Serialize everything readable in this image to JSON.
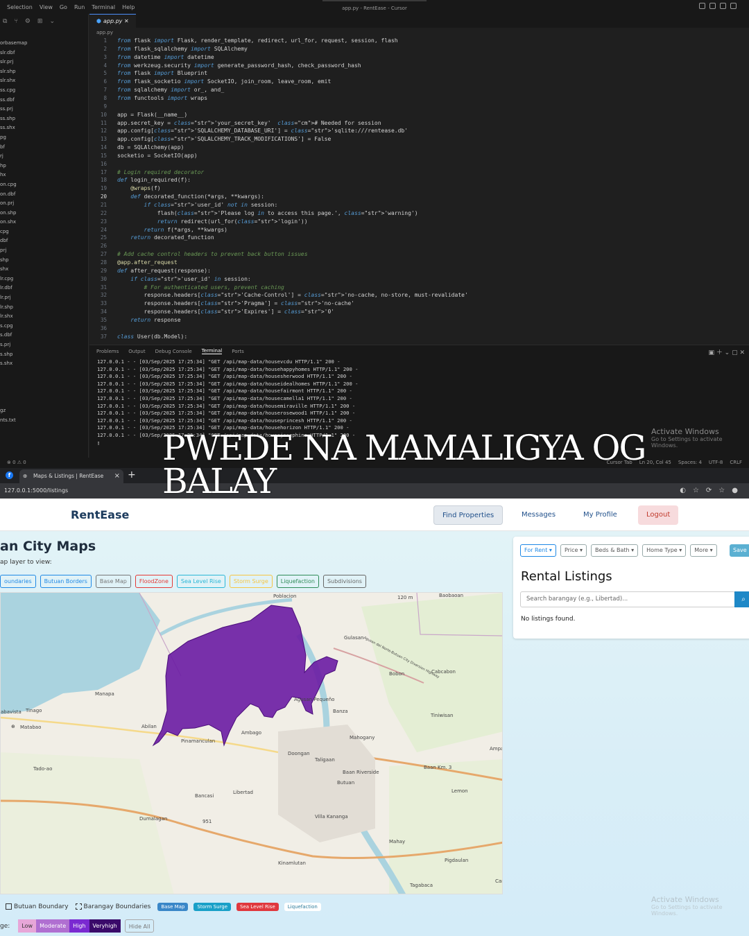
{
  "ide": {
    "menu": [
      "Selection",
      "View",
      "Go",
      "Run",
      "Terminal",
      "Help"
    ],
    "window_title": "app.py - RentEase - Cursor",
    "files": [
      "orbasemap",
      "slr.dbf",
      "slr.prj",
      "slr.shp",
      "slr.shx",
      "ss.cpg",
      "ss.dbf",
      "ss.prj",
      "ss.shp",
      "ss.shx",
      "pg",
      "bf",
      "rj",
      "hp",
      "hx",
      "on.cpg",
      "on.dbf",
      "on.prj",
      "on.shp",
      "on.shx",
      "cpg",
      "dbf",
      "prj",
      "shp",
      "shx",
      "lr.cpg",
      "lr.dbf",
      "lr.prj",
      "lr.shp",
      "lr.shx",
      "s.cpg",
      "s.dbf",
      "s.prj",
      "s.shp",
      "s.shx",
      "",
      "",
      "",
      "",
      "gz",
      "nts.txt"
    ],
    "tab": "app.py",
    "breadcrumb": "app.py",
    "code": [
      "from flask import Flask, render_template, redirect, url_for, request, session, flash",
      "from flask_sqlalchemy import SQLAlchemy",
      "from datetime import datetime",
      "from werkzeug.security import generate_password_hash, check_password_hash",
      "from flask import Blueprint",
      "from flask_socketio import SocketIO, join_room, leave_room, emit",
      "from sqlalchemy import or_, and_",
      "from functools import wraps",
      "",
      "app = Flask(__name__)",
      "app.secret_key = 'your_secret_key'  # Needed for session",
      "app.config['SQLALCHEMY_DATABASE_URI'] = 'sqlite:///rentease.db'",
      "app.config['SQLALCHEMY_TRACK_MODIFICATIONS'] = False",
      "db = SQLAlchemy(app)",
      "socketio = SocketIO(app)",
      "",
      "# Login required decorator",
      "def login_required(f):",
      "    @wraps(f)",
      "    def decorated_function(*args, **kwargs):",
      "        if 'user_id' not in session:",
      "            flash('Please log in to access this page.', 'warning')",
      "            return redirect(url_for('login'))",
      "        return f(*args, **kwargs)",
      "    return decorated_function",
      "",
      "# Add cache control headers to prevent back button issues",
      "@app.after_request",
      "def after_request(response):",
      "    if 'user_id' in session:",
      "        # For authenticated users, prevent caching",
      "        response.headers['Cache-Control'] = 'no-cache, no-store, must-revalidate'",
      "        response.headers['Pragma'] = 'no-cache'",
      "        response.headers['Expires'] = '0'",
      "    return response",
      "",
      "class User(db.Model):"
    ],
    "panel_tabs": [
      "Problems",
      "Output",
      "Debug Console",
      "Terminal",
      "Ports"
    ],
    "panel_active": "Terminal",
    "terminal": [
      "127.0.0.1 - - [03/Sep/2025 17:25:34] \"GET /api/map-data/housevcdu HTTP/1.1\" 200 -",
      "127.0.0.1 - - [03/Sep/2025 17:25:34] \"GET /api/map-data/househappyhomes HTTP/1.1\" 200 -",
      "127.0.0.1 - - [03/Sep/2025 17:25:34] \"GET /api/map-data/housesherwood HTTP/1.1\" 200 -",
      "127.0.0.1 - - [03/Sep/2025 17:25:34] \"GET /api/map-data/houseidealhomes HTTP/1.1\" 200 -",
      "127.0.0.1 - - [03/Sep/2025 17:25:34] \"GET /api/map-data/housefairmont HTTP/1.1\" 200 -",
      "127.0.0.1 - - [03/Sep/2025 17:25:34] \"GET /api/map-data/housecamella1 HTTP/1.1\" 200 -",
      "127.0.0.1 - - [03/Sep/2025 17:25:34] \"GET /api/map-data/housemiraville HTTP/1.1\" 200 -",
      "127.0.0.1 - - [03/Sep/2025 17:25:34] \"GET /api/map-data/houserosewood1 HTTP/1.1\" 200 -",
      "127.0.0.1 - - [03/Sep/2025 17:25:34] \"GET /api/map-data/houseprincesh HTTP/1.1\" 200 -",
      "127.0.0.1 - - [03/Sep/2025 17:25:34] \"GET /api/map-data/househorizon HTTP/1.1\" 200 -",
      "127.0.0.1 - - [03/Sep/2025 17:25:34] \"GET /api/map-data/housejosephine HTTP/1.1\" 200 -"
    ],
    "activate_title": "Activate Windows",
    "activate_sub": "Go to Settings to activate Windows.",
    "status_left": "⊗ 0 ⚠ 0",
    "status_right": [
      "Cursor Tab",
      "Ln 20, Col 45",
      "Spaces: 4",
      "UTF-8",
      "CRLF"
    ]
  },
  "caption": "PWEDE NA MAMALIGYA OG BALAY",
  "browser": {
    "tab_title": "Maps & Listings | RentEase",
    "url": "127.0.0.1:5000/listings"
  },
  "nav": {
    "brand": "RentEase",
    "find": "Find Properties",
    "messages": "Messages",
    "profile": "My Profile",
    "logout": "Logout"
  },
  "maps": {
    "title": "an City Maps",
    "subtitle": "ap layer to view:",
    "layer_buttons": [
      {
        "label": "oundaries",
        "color": "#1e88e5"
      },
      {
        "label": "Butuan Borders",
        "color": "#1e88e5"
      },
      {
        "label": "Base Map",
        "color": "#777777"
      },
      {
        "label": "FloodZone",
        "color": "#e53935"
      },
      {
        "label": "Sea Level Rise",
        "color": "#29b6d6"
      },
      {
        "label": "Storm Surge",
        "color": "#f5c542"
      },
      {
        "label": "Liquefaction",
        "color": "#2e8b57"
      },
      {
        "label": "Subdivisions",
        "color": "#666666"
      }
    ],
    "place_labels": [
      "Poblacion",
      "Baobaoan",
      "Gulasan",
      "Bobon",
      "Cabcabon",
      "Manapa",
      "Agusan Pequeño",
      "Banza",
      "Tiniwisan",
      "Abilan",
      "Ambago",
      "Mahogany",
      "Matabao",
      "Tinago",
      "Pinamanculan",
      "Doongan",
      "Ampa",
      "Taligaan",
      "Baan Riverside",
      "Baan Km. 3",
      "Butuan",
      "Lemon",
      "Bancasi",
      "Libertad",
      "Dumalagan",
      "Villa Kananga",
      "Mahay",
      "Kinamlutan",
      "Pigdaulan",
      "Tagabaca",
      "Cam",
      "Tado-ao",
      "abavista",
      "951",
      "120 m",
      "Agusan del Norte-Butuan City Diversion Highway"
    ],
    "legend": {
      "butuan_boundary": "Butuan Boundary",
      "barangay_boundaries": "Barangay Boundaries",
      "pills": [
        {
          "label": "Base Map",
          "color": "#3a87c8"
        },
        {
          "label": "Storm Surge",
          "color": "#19a0c8"
        },
        {
          "label": "Sea Level Rise",
          "color": "#e0383e"
        },
        {
          "label": "Liquefaction",
          "color": "#ffffff",
          "text": "#2a7a9a"
        }
      ]
    },
    "range_label": "ge:",
    "ranges": [
      {
        "label": "Low",
        "bg": "#e7a6d8",
        "fg": "#333333"
      },
      {
        "label": "Moderate",
        "bg": "#b06fd1",
        "fg": "#ffffff"
      },
      {
        "label": "High",
        "bg": "#7a2ad1",
        "fg": "#ffffff"
      },
      {
        "label": "Veryhigh",
        "bg": "#3a0a6a",
        "fg": "#ffffff"
      }
    ],
    "hide_all": "Hide All"
  },
  "listings": {
    "filters": [
      "For Rent",
      "Price",
      "Beds & Bath",
      "Home Type",
      "More"
    ],
    "save": "Save S",
    "title": "Rental Listings",
    "search_placeholder": "Search barangay (e.g., Libertad)...",
    "empty": "No listings found."
  },
  "colors": {
    "flood_polygon": "#6a1ba3",
    "brand": "#1b3a5c"
  }
}
